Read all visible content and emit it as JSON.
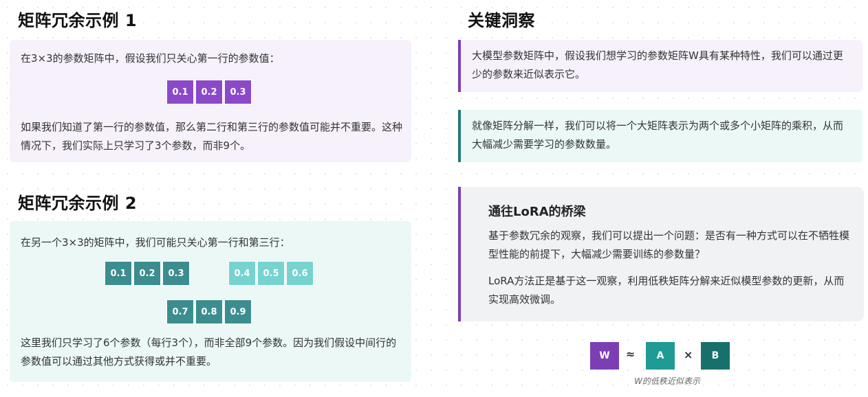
{
  "example1": {
    "title": "矩阵冗余示例 1",
    "intro": "在3×3的参数矩阵中，假设我们只关心第一行的参数值：",
    "row1": [
      "0.1",
      "0.2",
      "0.3"
    ],
    "explain": "如果我们知道了第一行的参数值，那么第二行和第三行的参数值可能并不重要。这种情况下，我们实际上只学习了3个参数，而非9个。"
  },
  "example2": {
    "title": "矩阵冗余示例 2",
    "intro": "在另一个3×3的矩阵中，我们可能只关心第一行和第三行：",
    "row1": [
      "0.1",
      "0.2",
      "0.3"
    ],
    "row2": [
      "0.4",
      "0.5",
      "0.6"
    ],
    "row3": [
      "0.7",
      "0.8",
      "0.9"
    ],
    "explain": "这里我们只学习了6个参数（每行3个），而非全部9个参数。因为我们假设中间行的参数值可以通过其他方式获得或并不重要。"
  },
  "insights": {
    "title": "关键洞察",
    "card1": "大模型参数矩阵中，假设我们想学习的参数矩阵W具有某种特性，我们可以通过更少的参数来近似表示它。",
    "card2": "就像矩阵分解一样，我们可以将一个大矩阵表示为两个或多个小矩阵的乘积，从而大幅减少需要学习的参数数量。"
  },
  "bridge": {
    "title": "通往LoRA的桥梁",
    "p1": "基于参数冗余的观察，我们可以提出一个问题：是否有一种方式可以在不牺牲模型性能的前提下，大幅减少需要训练的参数量？",
    "p2": "LoRA方法正是基于这一观察，利用低秩矩阵分解来近似模型参数的更新，从而实现高效微调。"
  },
  "formula": {
    "w": "W",
    "approx": "≈",
    "a": "A",
    "times": "×",
    "b": "B",
    "caption": "W的低秩近似表示"
  },
  "colors": {
    "purple": "#8b49c9",
    "teal_dark": "#3c8d8f",
    "teal_light": "#76d3cf",
    "formula_a": "#1f9a94",
    "formula_b": "#17706b"
  }
}
